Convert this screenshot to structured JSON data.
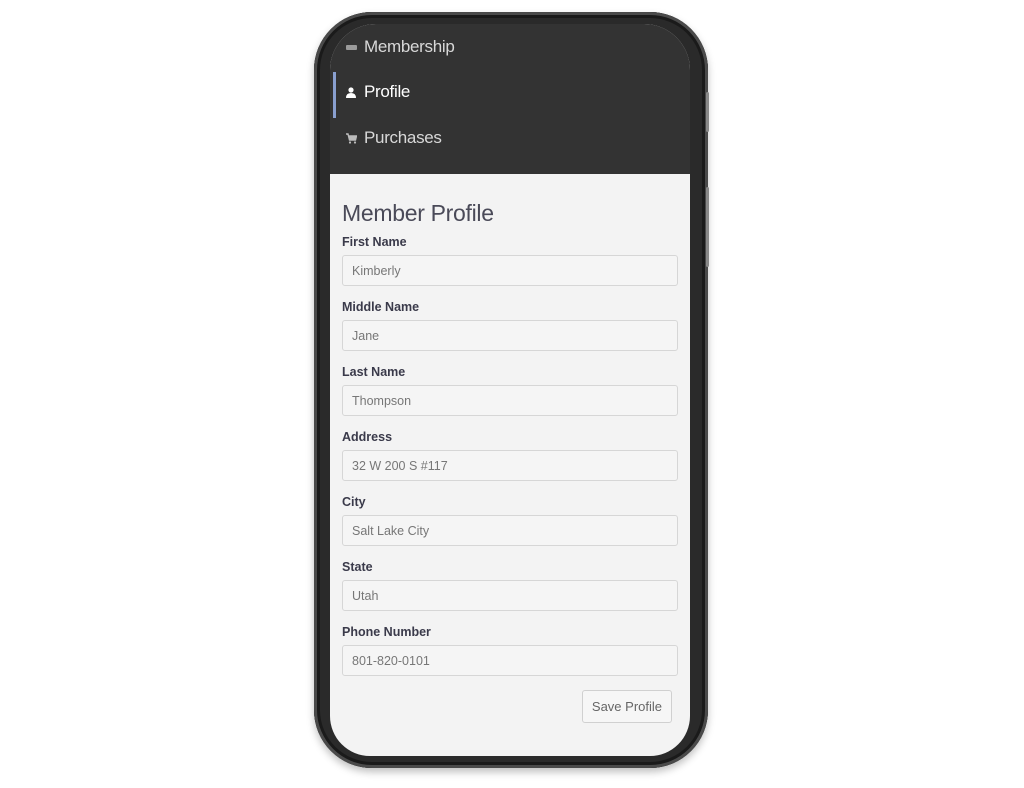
{
  "nav": {
    "items": [
      {
        "label": "Membership",
        "icon": "membership-card-icon",
        "glyph": "▬"
      },
      {
        "label": "Profile",
        "icon": "user-icon",
        "glyph": "●",
        "active": true
      },
      {
        "label": "Purchases",
        "icon": "cart-icon",
        "glyph": "🛒"
      }
    ]
  },
  "page": {
    "title": "Member Profile",
    "fields": [
      {
        "label": "First Name",
        "value": "Kimberly"
      },
      {
        "label": "Middle Name",
        "value": "Jane"
      },
      {
        "label": "Last Name",
        "value": "Thompson"
      },
      {
        "label": "Address",
        "value": "32 W 200 S #117"
      },
      {
        "label": "City",
        "value": "Salt Lake City"
      },
      {
        "label": "State",
        "value": "Utah"
      },
      {
        "label": "Phone Number",
        "value": "801-820-0101"
      }
    ],
    "save_label": "Save Profile"
  }
}
